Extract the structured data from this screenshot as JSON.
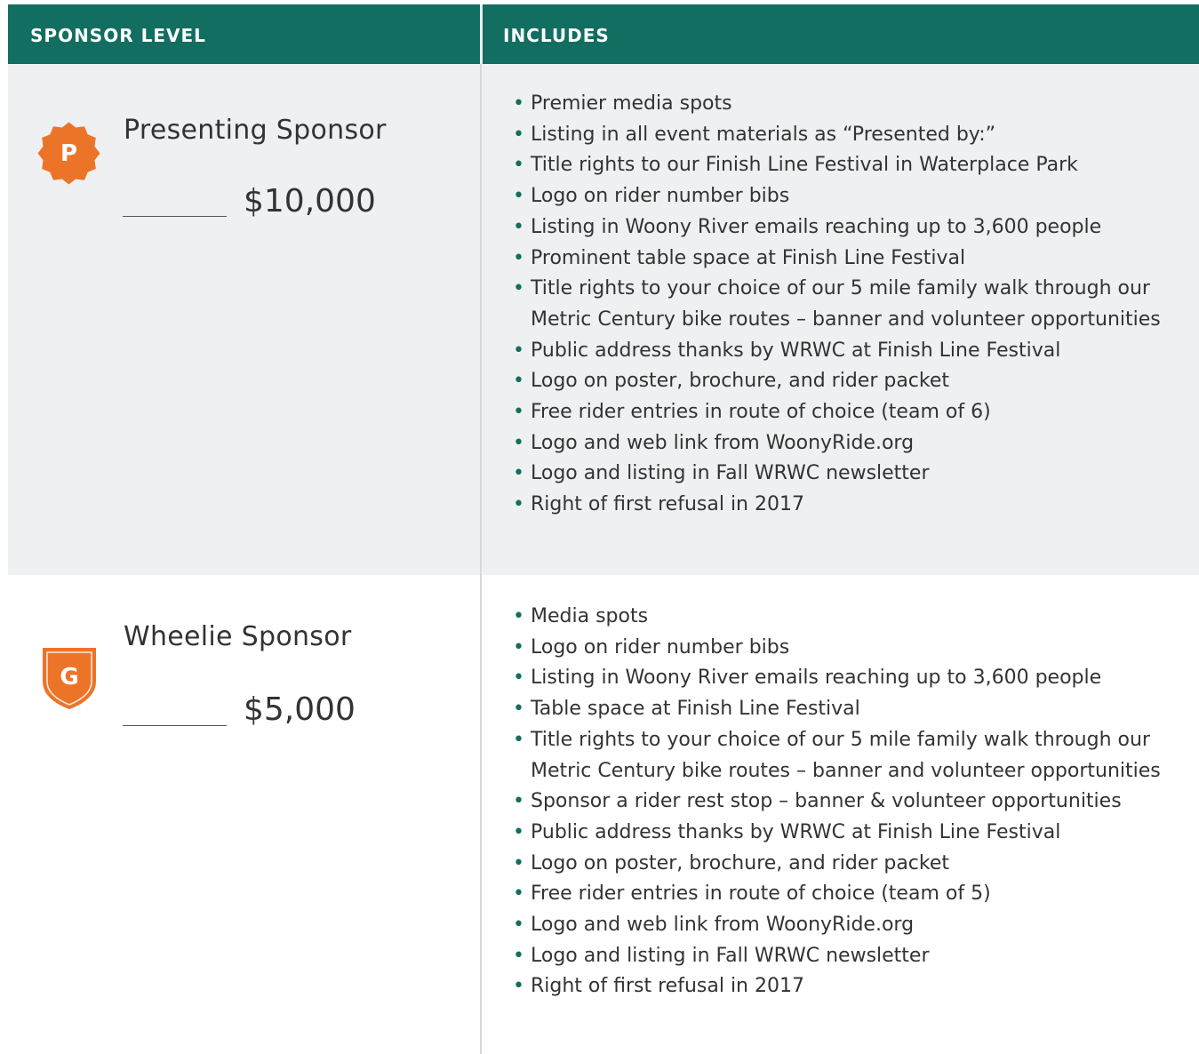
{
  "header": {
    "level_label": "SPONSOR LEVEL",
    "includes_label": "INCLUDES"
  },
  "colors": {
    "header_bg": "#116e60",
    "badge_orange": "#ec7428",
    "row_shade": "#eff0f1"
  },
  "sponsors": [
    {
      "badge_letter": "P",
      "badge_shape": "starburst",
      "name": "Presenting Sponsor",
      "amount": "$10,000",
      "includes": [
        "Premier media spots",
        "Listing in all event materials as “Presented by:”",
        "Title rights to our Finish Line Festival in Waterplace Park",
        "Logo on rider number bibs",
        "Listing in Woony River emails reaching up to 3,600 people",
        "Prominent table space at Finish Line Festival",
        "Title rights to your choice of our 5 mile family walk through our Metric Century bike routes – banner and volunteer opportunities",
        "Public address thanks by WRWC at Finish Line Festival",
        "Logo on poster, brochure, and rider packet",
        "Free rider entries in route of choice (team of 6)",
        "Logo and web link from WoonyRide.org",
        "Logo and listing in Fall WRWC newsletter",
        "Right of first refusal in 2017"
      ]
    },
    {
      "badge_letter": "G",
      "badge_shape": "shield",
      "name": "Wheelie Sponsor",
      "amount": "$5,000",
      "includes": [
        "Media spots",
        "Logo on rider number bibs",
        "Listing in Woony River emails reaching up to 3,600 people",
        "Table space at Finish Line Festival",
        "Title rights to your choice of our 5 mile family walk through our Metric Century bike routes – banner and volunteer opportunities",
        "Sponsor a rider rest stop – banner & volunteer opportunities",
        "Public address thanks by WRWC at Finish Line Festival",
        "Logo on poster, brochure, and rider packet",
        "Free rider entries in route of choice (team of 5)",
        "Logo and web link from WoonyRide.org",
        "Logo and listing in Fall WRWC newsletter",
        "Right of first refusal in 2017"
      ]
    }
  ]
}
